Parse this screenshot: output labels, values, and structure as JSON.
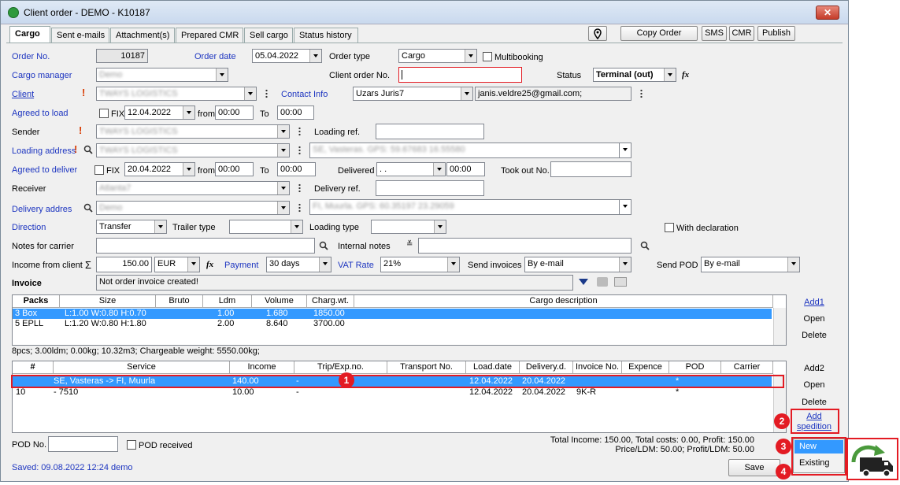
{
  "window": {
    "title": "Client order - DEMO  - K10187",
    "close": "✕"
  },
  "tabs": [
    "Cargo",
    "Sent e-mails",
    "Attachment(s)",
    "Prepared CMR",
    "Sell cargo",
    "Status history"
  ],
  "toolbar": {
    "copy_order": "Copy Order",
    "sms": "SMS",
    "cmr": "CMR",
    "publish": "Publish"
  },
  "form": {
    "order_no_label": "Order No.",
    "order_no": "10187",
    "order_date_label": "Order date",
    "order_date": "05.04.2022",
    "order_type_label": "Order type",
    "order_type": "Cargo",
    "multibooking_label": "Multibooking",
    "cargo_manager_label": "Cargo manager",
    "cargo_manager": "Demo",
    "client_order_no_label": "Client order No.",
    "client_order_no": "",
    "status_label": "Status",
    "status": "Terminal (out)",
    "client_label": "Client",
    "client": "TWAYS LOGISTICS",
    "contact_info_label": "Contact Info",
    "contact": "Uzars Juris7",
    "contact_email": "janis.veldre25@gmail.com;",
    "agreed_load_label": "Agreed to load",
    "fix_label": "FIX",
    "load_date": "12.04.2022",
    "from_label": "from",
    "load_from": "00:00",
    "to_label": "To",
    "load_to": "00:00",
    "sender_label": "Sender",
    "sender": "TWAYS LOGISTICS",
    "loading_ref_label": "Loading ref.",
    "loading_address_label": "Loading address",
    "loading_company": "TWAYS LOGISTICS",
    "loading_address": "SE, Vasteras. GPS: 59.67683 16.55580",
    "agreed_deliver_label": "Agreed to deliver",
    "deliver_date": "20.04.2022",
    "deliver_from": "00:00",
    "deliver_to": "00:00",
    "delivered_label": "Delivered",
    "delivered_date": "  .  .",
    "delivered_time": "00:00",
    "took_out_label": "Took out No.",
    "receiver_label": "Receiver",
    "receiver": "Atlanta7",
    "delivery_ref_label": "Delivery ref.",
    "delivery_address_label": "Delivery addres",
    "delivery_company": "Demo",
    "delivery_address": "FI, Muurla. GPS: 60.35197 23.29059",
    "direction_label": "Direction",
    "direction": "Transfer",
    "trailer_type_label": "Trailer type",
    "loading_type_label": "Loading type",
    "with_declaration_label": "With declaration",
    "notes_carrier_label": "Notes for carrier",
    "internal_notes_label": "Internal notes",
    "income_label": "Income from client",
    "sigma": "Σ",
    "income": "150.00",
    "currency": "EUR",
    "fx": "fx",
    "payment_label": "Payment",
    "payment": "30 days",
    "vat_label": "VAT Rate",
    "vat": "21%",
    "send_invoices_label": "Send invoices",
    "send_invoices": "By e-mail",
    "send_pod_label": "Send POD",
    "send_pod": "By e-mail",
    "invoice_label": "Invoice",
    "invoice_status": "Not order invoice created!"
  },
  "packs_table": {
    "headers": [
      "Packs",
      "Size",
      "Bruto",
      "Ldm",
      "Volume",
      "Charg.wt.",
      "Cargo description"
    ],
    "rows": [
      [
        "3 Box",
        "L:1.00 W:0.80 H:0.70",
        "",
        "1.00",
        "1.680",
        "1850.00",
        ""
      ],
      [
        "5 EPLL",
        "L:1.20 W:0.80 H:1.80",
        "",
        "2.00",
        "8.640",
        "3700.00",
        ""
      ]
    ],
    "summary": "8pcs; 3.00ldm; 0.00kg; 10.32m3; Chargeable weight: 5550.00kg;",
    "add": "Add1",
    "open": "Open",
    "delete": "Delete"
  },
  "services_table": {
    "headers": [
      "#",
      "Service",
      "Income",
      "Trip/Exp.no.",
      "Transport No.",
      "Load.date",
      "Delivery.d.",
      "Invoice No.",
      "Expence",
      "POD",
      "Carrier"
    ],
    "rows": [
      [
        "",
        "SE, Vasteras -> FI, Muurla",
        "140.00",
        "-",
        "",
        "12.04.2022",
        "20.04.2022",
        "",
        "",
        "*",
        ""
      ],
      [
        "10",
        "- 7510",
        "10.00",
        "-",
        "",
        "12.04.2022",
        "20.04.2022",
        "9K-R",
        "",
        "*",
        ""
      ]
    ],
    "add": "Add2",
    "open": "Open",
    "delete": "Delete",
    "add_spedition": "Add spedition"
  },
  "footer": {
    "pod_no_label": "POD No.",
    "pod_received_label": "POD received",
    "totals_line1": "Total Income: 150.00, Total costs: 0.00, Profit: 150.00",
    "totals_line2": "Price/LDM: 50.00; Profit/LDM: 50.00",
    "saved": "Saved: 09.08.2022 12:24 demo",
    "save": "Save"
  },
  "popup_menu": {
    "new": "New",
    "existing": "Existing"
  },
  "callouts": [
    "1",
    "2",
    "3",
    "4"
  ],
  "colors": {
    "accent_blue": "#1d35c0",
    "selection": "#3399ff",
    "callout_red": "#e31b23"
  }
}
